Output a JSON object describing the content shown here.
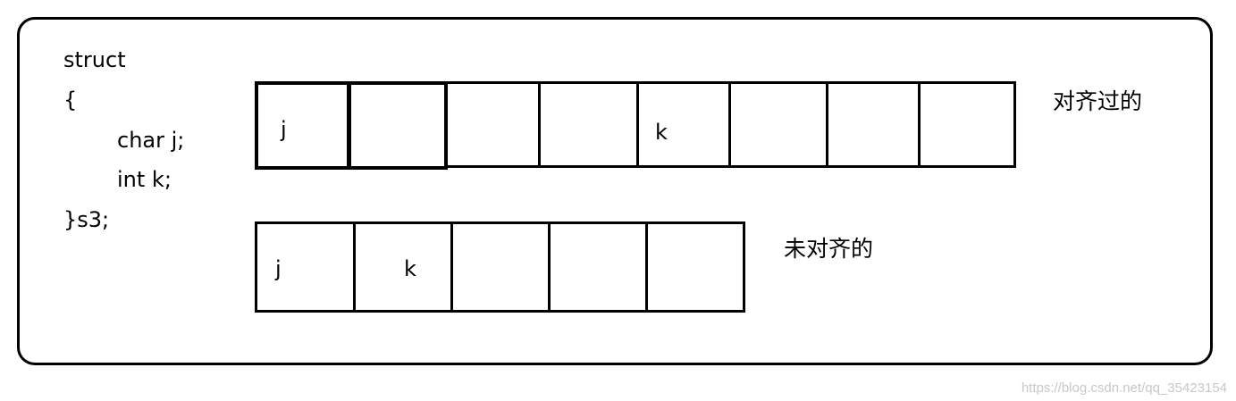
{
  "code": {
    "line1": "struct",
    "line2": "{",
    "line3": "char j;",
    "line4": "int k;",
    "line5": "}s3;"
  },
  "aligned": {
    "label": "对齐过的",
    "cells": [
      "j",
      "",
      "",
      "",
      "k",
      "",
      "",
      ""
    ]
  },
  "unaligned": {
    "label": "未对齐的",
    "cells": [
      "j",
      "k",
      "",
      "",
      ""
    ]
  },
  "watermark": "https://blog.csdn.net/qq_35423154"
}
